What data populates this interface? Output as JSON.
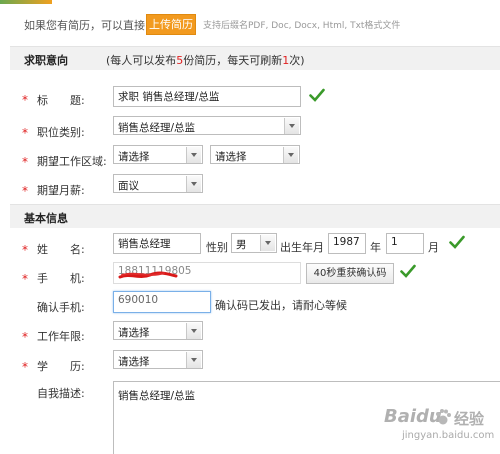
{
  "header": {
    "has_resume_text": "如果您有简历，可以直接",
    "upload_button": "上传简历",
    "formats_hint": "支持后缀名PDF, Doc, Docx, Html, Txt格式文件"
  },
  "section_intent": {
    "title": "求职意向",
    "note_prefix": "(每人可以发布",
    "note_count": "5",
    "note_suffix": "份简历，每天可刷新",
    "note_refresh": "1",
    "note_end": "次)"
  },
  "intent_fields": {
    "title_label": "标　　题:",
    "title_value": "求职 销售总经理/总监",
    "category_label": "职位类别:",
    "category_value": "销售总经理/总监",
    "area_label": "期望工作区域:",
    "area_value_1": "请选择",
    "area_value_2": "请选择",
    "salary_label": "期望月薪:",
    "salary_value": "面议"
  },
  "section_basic": {
    "title": "基本信息"
  },
  "basic_fields": {
    "name_label": "姓　　名:",
    "name_value": "销售总经理",
    "gender_label": "性别",
    "gender_value": "男",
    "birth_label": "出生年月",
    "birth_year": "1987",
    "year_unit": "年",
    "birth_month": "1",
    "month_unit": "月",
    "phone_label": "手　　机:",
    "phone_value": "18811119805",
    "resend_button": "40秒重获确认码",
    "confirm_label": "确认手机:",
    "confirm_value": "690010",
    "confirm_hint": "确认码已发出，请耐心等候",
    "years_label": "工作年限:",
    "years_value": "请选择",
    "edu_label": "学　　历:",
    "edu_value": "请选择",
    "desc_label": "自我描述:",
    "desc_value": "销售总经理/总监"
  },
  "required_mark": "*",
  "watermark": {
    "brand": "Baidu",
    "brand_cn": "经验",
    "url": "jingyan.baidu.com"
  },
  "colors": {
    "accent_orange": "#f29a1f",
    "required_red": "#e02020",
    "check_green": "#3a9a2a",
    "section_bg": "#f1f1f1"
  }
}
